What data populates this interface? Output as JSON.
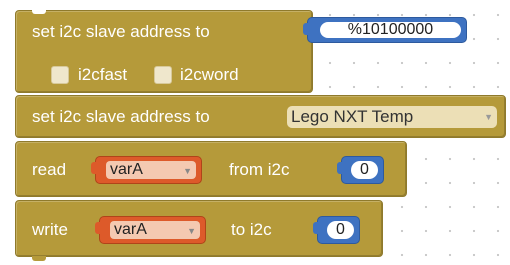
{
  "blocks": {
    "set_address_1": {
      "label": "set i2c slave address to",
      "value": "%10100000",
      "option1_label": "i2cfast",
      "option2_label": "i2cword",
      "option1_checked": false,
      "option2_checked": false
    },
    "set_address_2": {
      "label": "set i2c slave address to",
      "value": "Lego NXT Temp"
    },
    "read": {
      "label": "read",
      "variable": "varA",
      "from_label": "from i2c",
      "index": "0"
    },
    "write": {
      "label": "write",
      "variable": "varA",
      "to_label": "to i2c",
      "index": "0"
    }
  },
  "colors": {
    "block": "#b59a3a",
    "number_block": "#3e72c1",
    "variable_block": "#dd5a2a"
  },
  "icons": {
    "dropdown": "dropdown-arrow-icon"
  }
}
